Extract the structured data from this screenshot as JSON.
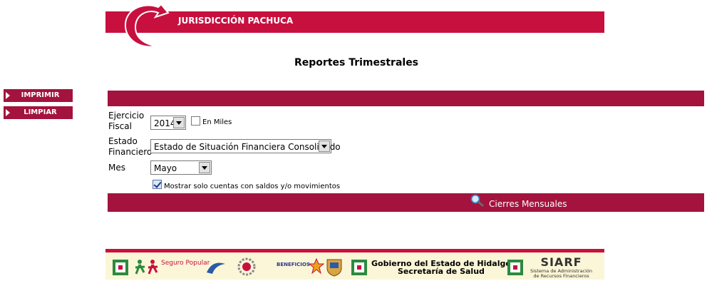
{
  "header": {
    "title": "JURISDICCIÓN PACHUCA",
    "brand_color": "#c8103f",
    "logo": "swirl-logo"
  },
  "page": {
    "title": "Reportes Trimestrales"
  },
  "sidebar": {
    "items": [
      {
        "label": "IMPRIMIR",
        "icon": "play-arrow-icon"
      },
      {
        "label": "LIMPIAR",
        "icon": "play-arrow-icon"
      }
    ],
    "color": "#a3133d"
  },
  "form": {
    "ejercicio_label_1": "Ejercicio",
    "ejercicio_label_2": "Fiscal",
    "ejercicio_value": "2014",
    "en_miles_label": "En Miles",
    "en_miles_checked": false,
    "estado_label_1": "Estado",
    "estado_label_2": "Financiero",
    "estado_value": "Estado de Situación Financiera Consolidado",
    "mes_label": "Mes",
    "mes_value": "Mayo",
    "mostrar_label": "Mostrar solo cuentas con saldos y/o movimientos",
    "mostrar_checked": true
  },
  "action": {
    "label": "Cierres Mensuales",
    "icon": "magnifier-icon"
  },
  "footer": {
    "seguro_popular": "Seguro Popular",
    "beneficios": "BENEFICIOS",
    "gov_line1": "Gobierno del Estado de Hidalgo",
    "gov_line2": "Secretaría de Salud",
    "siarf": "SIARF",
    "siarf_sub1": "Sistema de Administración",
    "siarf_sub2": "de Recursos Financieros"
  }
}
